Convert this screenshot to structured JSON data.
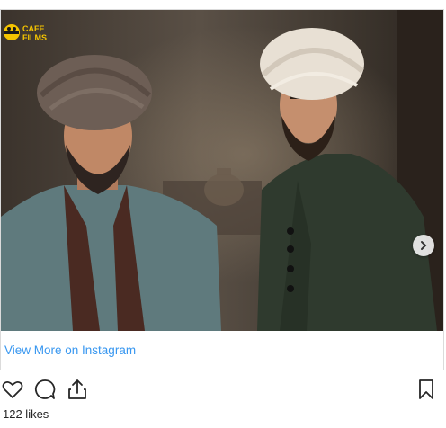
{
  "watermark": {
    "line1": "CAFE",
    "line2": "FILMS"
  },
  "post": {
    "view_more_label": "View More on Instagram",
    "likes_label": "122 likes"
  },
  "icons": {
    "like": "heart-icon",
    "comment": "comment-icon",
    "share": "share-icon",
    "save": "bookmark-icon",
    "next": "chevron-right-icon"
  },
  "colors": {
    "link": "#3897f0",
    "text": "#262626",
    "border": "#dbdbdb"
  }
}
